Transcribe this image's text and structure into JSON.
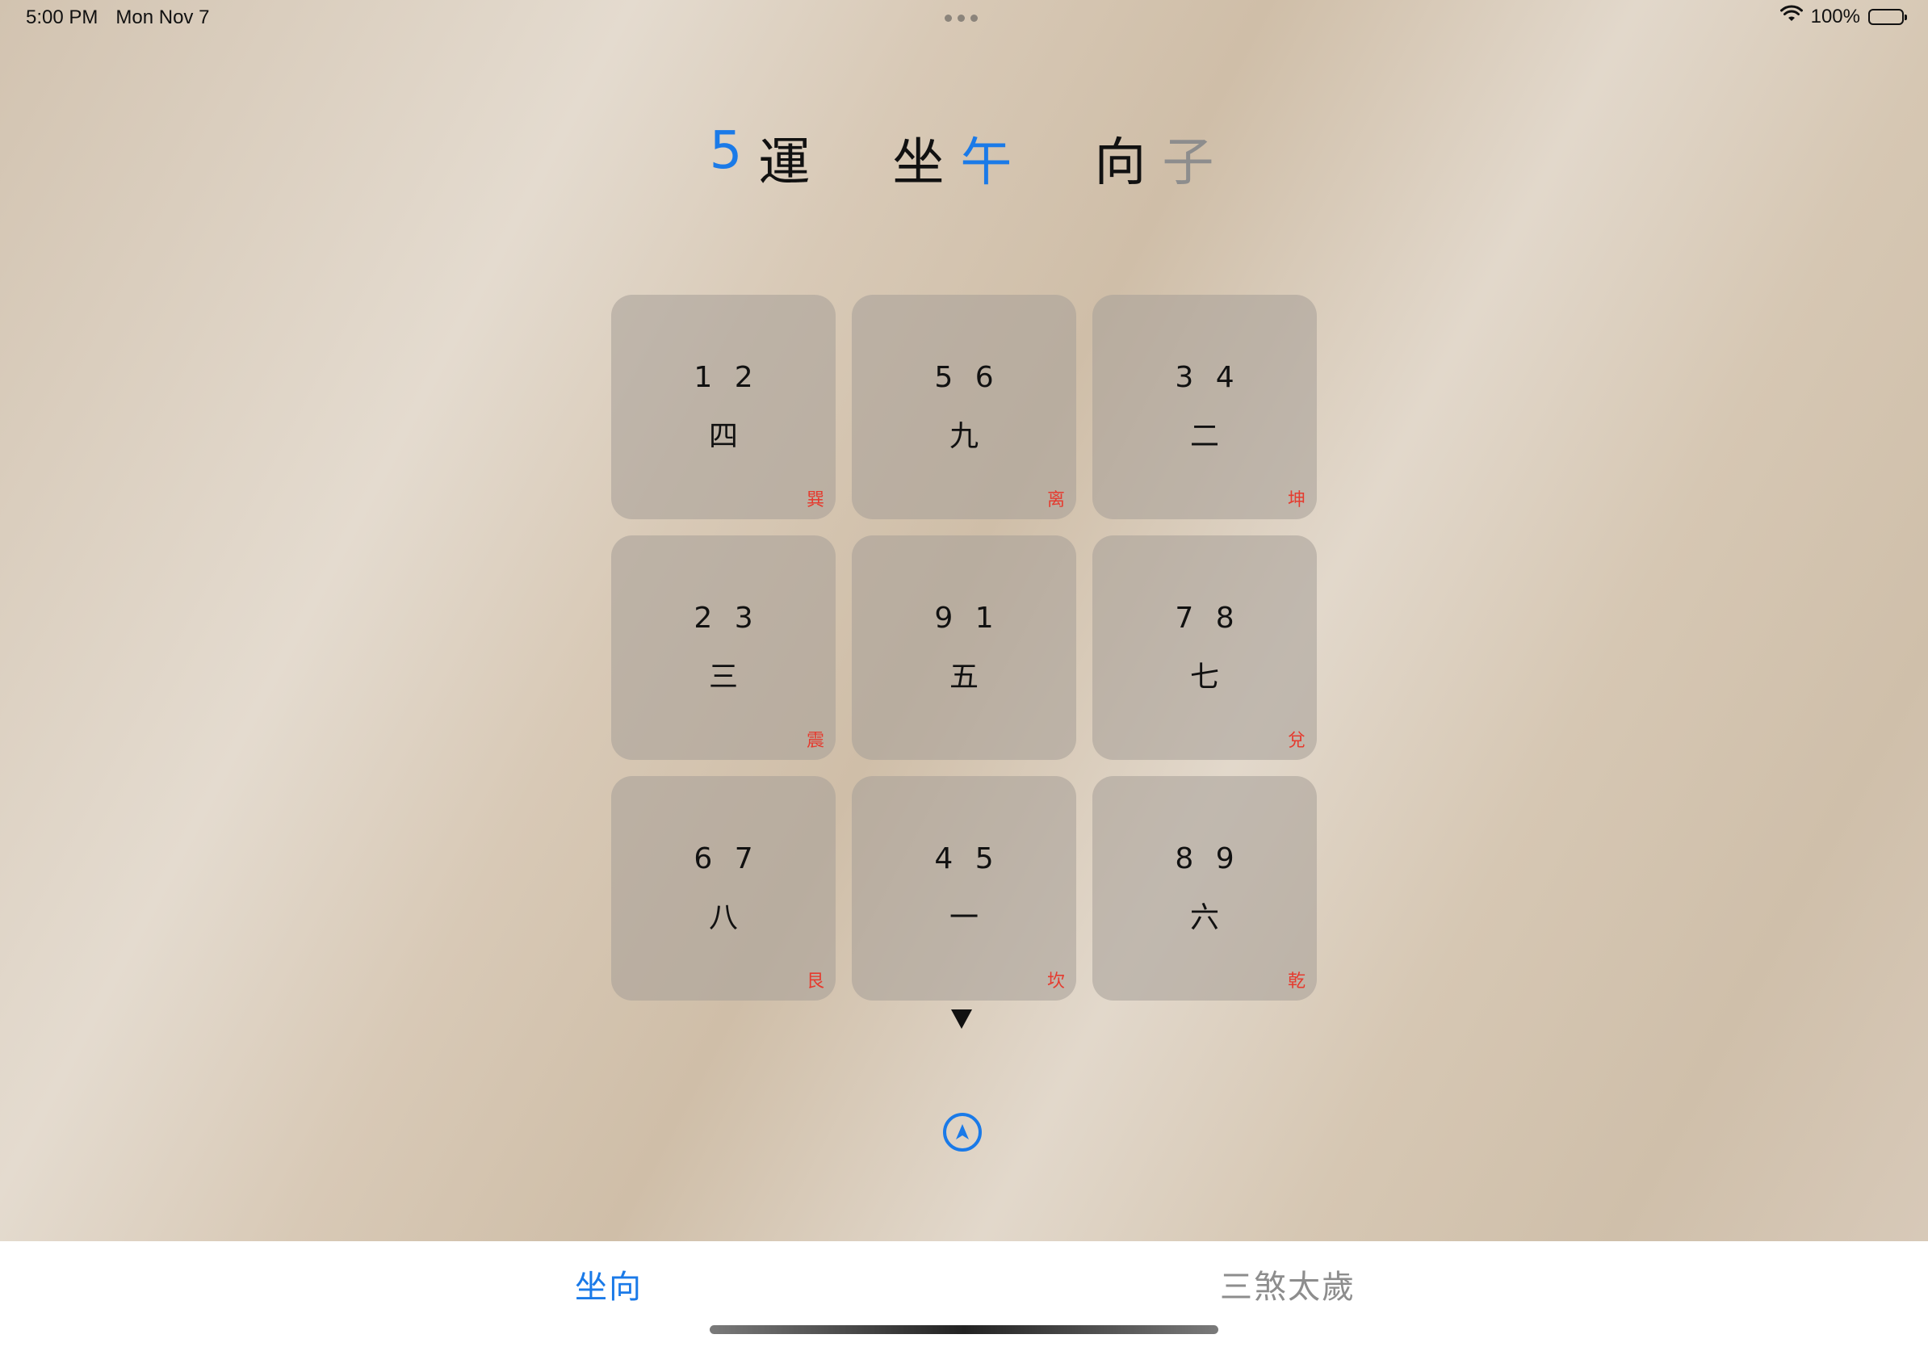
{
  "status_bar": {
    "time": "5:00 PM",
    "date": "Mon Nov 7",
    "battery": "100%",
    "wifi_icon": "wifi-icon",
    "battery_icon": "battery-full-icon"
  },
  "header": {
    "period_number": "5",
    "period_label": "運",
    "sitting_label": "坐",
    "sitting_value": "午",
    "facing_label": "向",
    "facing_value": "子"
  },
  "grid": {
    "cells": [
      {
        "stars": "1 2",
        "base": "四",
        "trigram": "巽"
      },
      {
        "stars": "5 6",
        "base": "九",
        "trigram": "离"
      },
      {
        "stars": "3 4",
        "base": "二",
        "trigram": "坤"
      },
      {
        "stars": "2 3",
        "base": "三",
        "trigram": "震"
      },
      {
        "stars": "9 1",
        "base": "五",
        "trigram": ""
      },
      {
        "stars": "7 8",
        "base": "七",
        "trigram": "兌"
      },
      {
        "stars": "6 7",
        "base": "八",
        "trigram": "艮"
      },
      {
        "stars": "4 5",
        "base": "一",
        "trigram": "坎"
      },
      {
        "stars": "8 9",
        "base": "六",
        "trigram": "乾"
      }
    ]
  },
  "pointer_icon": "triangle-down-icon",
  "compass_icon": "location-arrow-icon",
  "tabs": {
    "zuoxiang": "坐向",
    "sansha": "三煞太歲"
  },
  "colors": {
    "accent": "#1a7ae8",
    "trigram": "#e53b2f",
    "inactive": "#8d8d8d"
  }
}
